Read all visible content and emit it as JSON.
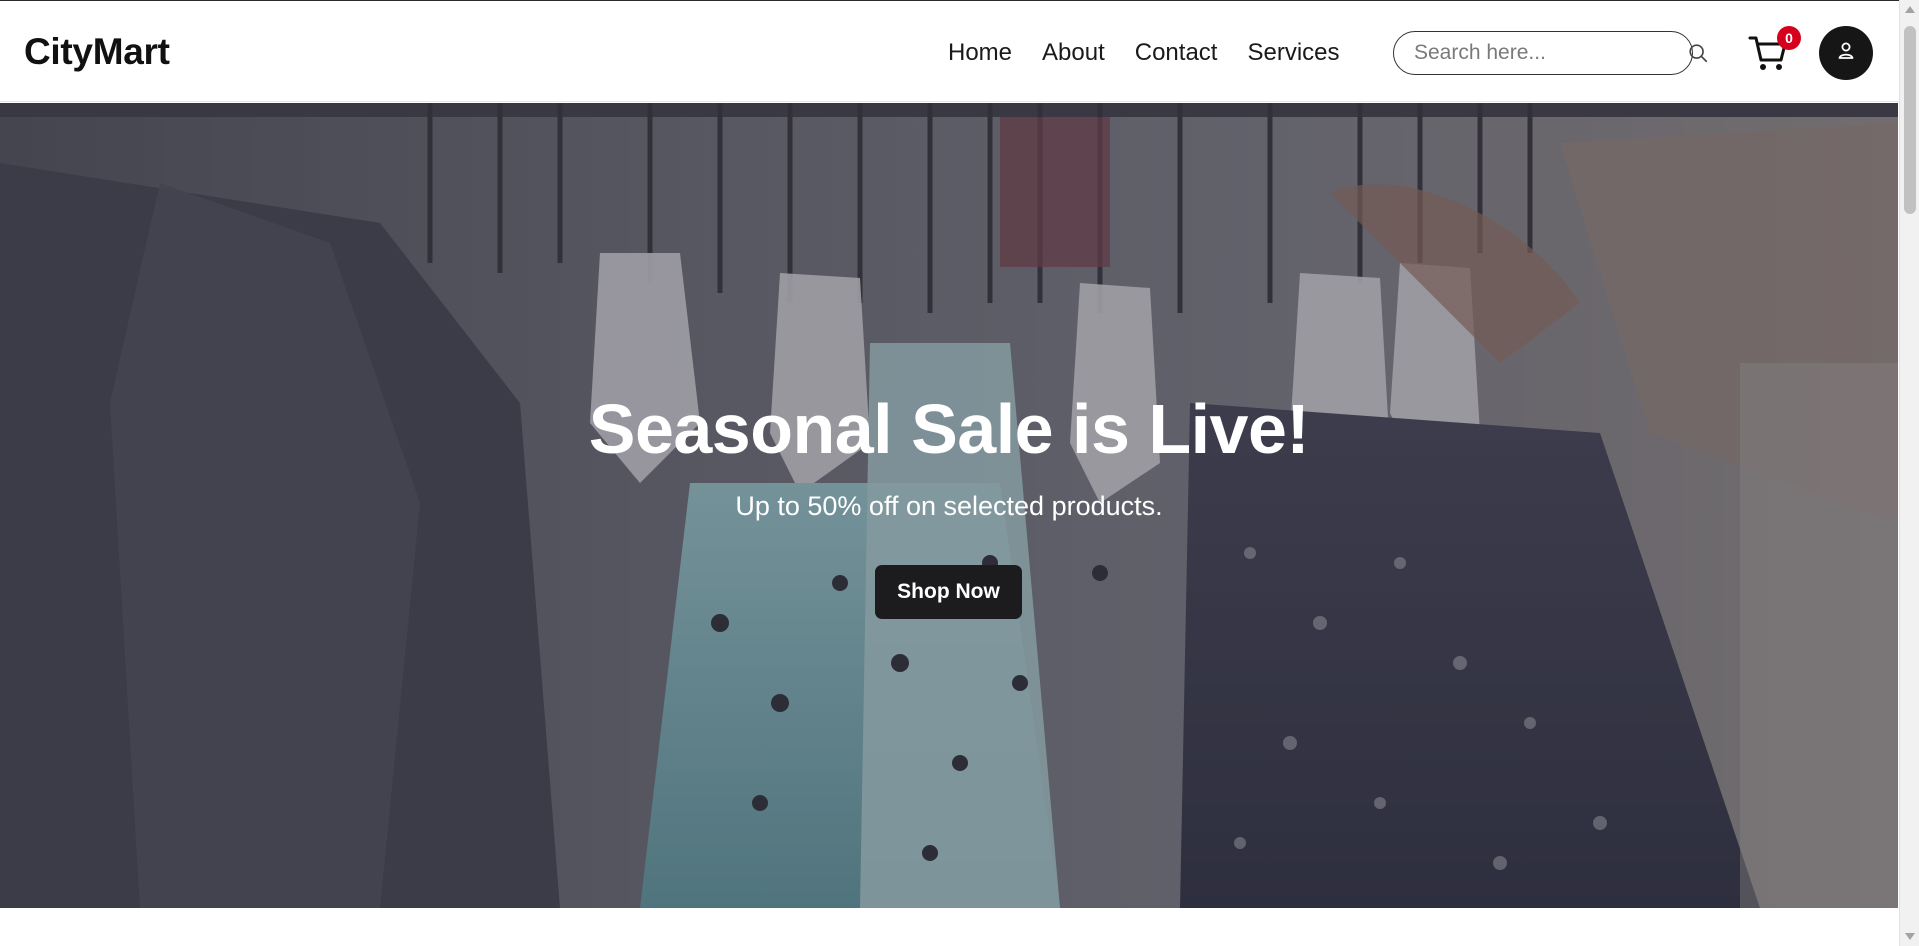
{
  "brand": {
    "name": "CityMart"
  },
  "nav": {
    "links": [
      {
        "label": "Home"
      },
      {
        "label": "About"
      },
      {
        "label": "Contact"
      },
      {
        "label": "Services"
      }
    ]
  },
  "search": {
    "placeholder": "Search here...",
    "value": "",
    "icon": "search-icon"
  },
  "cart": {
    "icon": "cart-icon",
    "count": "0",
    "badge_color": "#d6001c"
  },
  "account": {
    "icon": "user-icon"
  },
  "hero": {
    "title": "Seasonal Sale is Live!",
    "subtitle": "Up to 50% off on selected products.",
    "button_label": "Shop Now",
    "background": "clothing-rack-photo"
  },
  "colors": {
    "accent_dark": "#1c1c1f",
    "badge_red": "#d6001c",
    "text_dark": "#111111"
  }
}
